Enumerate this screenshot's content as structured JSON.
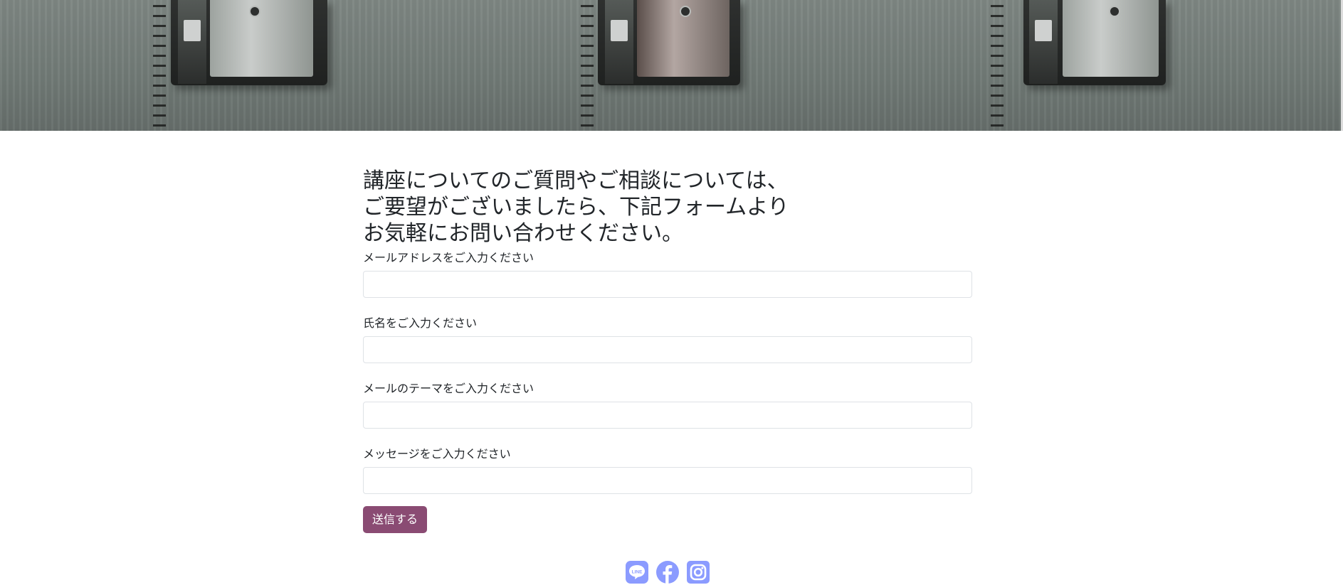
{
  "hero": {
    "image": "wall-mounted-payphones-photo"
  },
  "contact": {
    "heading": "講座についてのご質問やご相談については、\nご要望がございましたら、下記フォームより\nお気軽にお問い合わせください。",
    "fields": [
      {
        "label": "メールアドレスをご入力ください",
        "value": ""
      },
      {
        "label": "氏名をご入力ください",
        "value": ""
      },
      {
        "label": "メールのテーマをご入力ください",
        "value": ""
      },
      {
        "label": "メッセージをご入力ください",
        "value": ""
      }
    ],
    "submit_label": "送信する"
  },
  "social": {
    "icons": [
      "line-icon",
      "facebook-icon",
      "instagram-icon"
    ],
    "line_badge_text": "LINE"
  },
  "colors": {
    "accent": "#8a4b73",
    "social_icon": "#8b9bff"
  }
}
